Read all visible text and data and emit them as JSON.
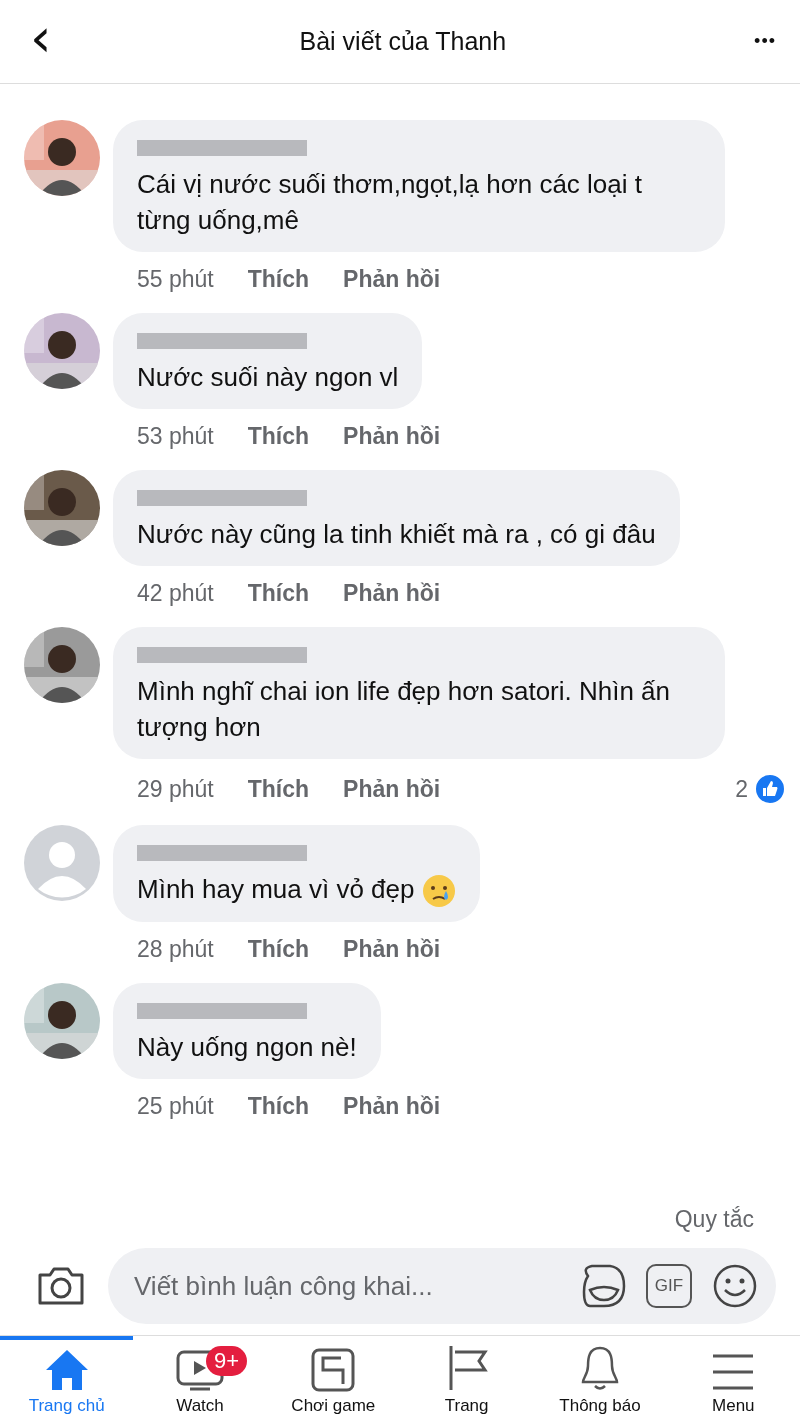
{
  "header": {
    "back": "‹",
    "title": "Bài viết của Thanh",
    "more": "•••"
  },
  "comments": [
    {
      "text": "Cái vị nước suối thơm,ngọt,lạ hơn các loại t từng uống,mê",
      "time": "55 phút",
      "like": "Thích",
      "reply": "Phản hồi"
    },
    {
      "text": "Nước suối này ngon vl",
      "time": "53 phút",
      "like": "Thích",
      "reply": "Phản hồi"
    },
    {
      "text": "Nước này cũng la tinh khiết mà ra , có gi đâu",
      "time": "42 phút",
      "like": "Thích",
      "reply": "Phản hồi"
    },
    {
      "text": "Mình nghĩ chai ion life đẹp hơn satori. Nhìn ấn tượng hơn",
      "time": "29 phút",
      "like": "Thích",
      "reply": "Phản hồi",
      "reactions": "2"
    },
    {
      "kind": "default",
      "text": "Mình hay mua vì vỏ đẹp",
      "emoji": true,
      "time": "28 phút",
      "like": "Thích",
      "reply": "Phản hồi"
    },
    {
      "text": "Này uống ngon nè!",
      "time": "25 phút",
      "like": "Thích",
      "reply": "Phản hồi"
    }
  ],
  "rules_link": "Quy tắc",
  "composer": {
    "placeholder": "Viết bình luận công khai...",
    "gif": "GIF"
  },
  "tabs": [
    {
      "kind": "home",
      "label": "Trang chủ",
      "selected": true
    },
    {
      "kind": "watch",
      "label": "Watch",
      "selected": false,
      "badge": "9+"
    },
    {
      "kind": "game",
      "label": "Chơi game",
      "selected": false
    },
    {
      "kind": "page",
      "label": "Trang",
      "selected": false
    },
    {
      "kind": "bell",
      "label": "Thông báo",
      "selected": false
    },
    {
      "kind": "menu",
      "label": "Menu",
      "selected": false
    }
  ]
}
